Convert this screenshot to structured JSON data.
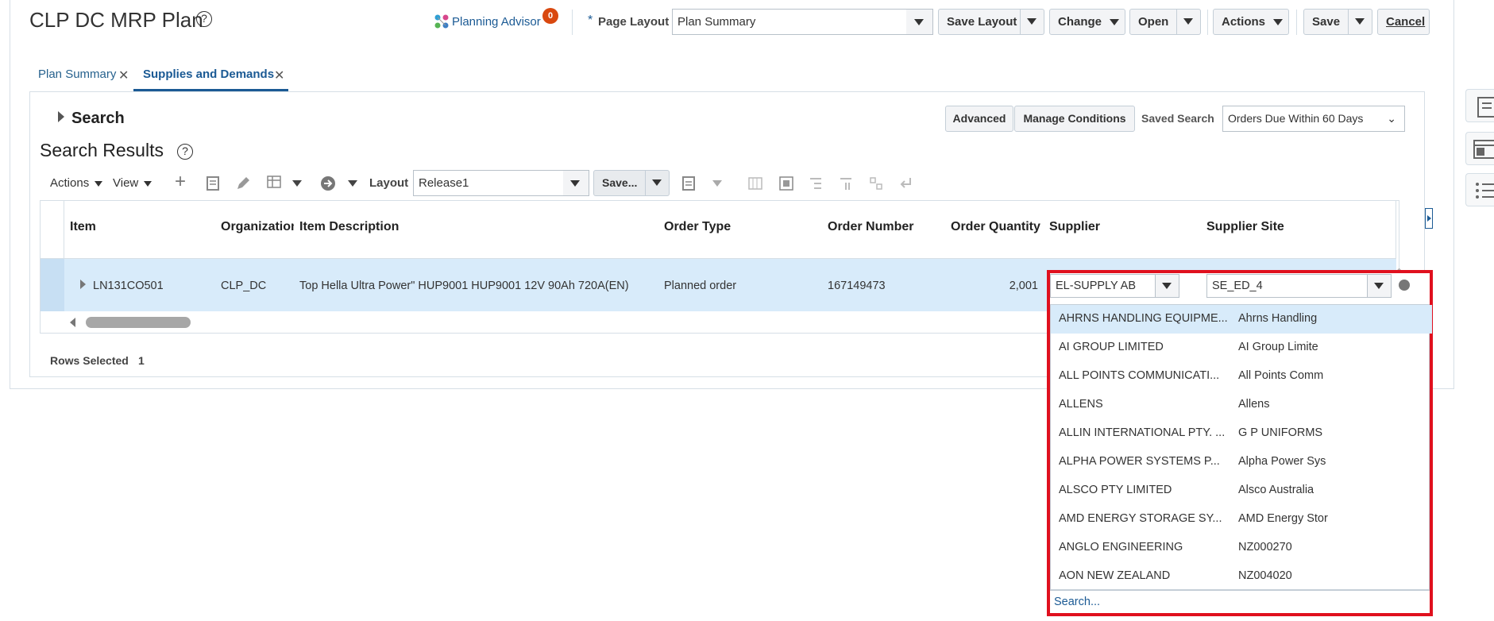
{
  "header": {
    "title": "CLP DC MRP Plan",
    "planning_advisor": "Planning Advisor",
    "advisor_badge": "0",
    "page_layout_label": "Page Layout",
    "page_layout_value": "Plan Summary",
    "save_layout": "Save Layout",
    "change": "Change",
    "open": "Open",
    "actions": "Actions",
    "save": "Save",
    "cancel": "Cancel"
  },
  "tabs": [
    {
      "label": "Plan Summary"
    },
    {
      "label": "Supplies and Demands"
    }
  ],
  "search": {
    "label": "Search",
    "advanced": "Advanced",
    "manage_conditions": "Manage Conditions",
    "saved_search_label": "Saved Search",
    "saved_search_value": "Orders Due Within 60 Days"
  },
  "results": {
    "title": "Search Results",
    "actions": "Actions",
    "view": "View",
    "layout_label": "Layout",
    "layout_value": "Release1",
    "save_btn": "Save...",
    "rows_selected_label": "Rows Selected",
    "rows_selected_count": "1"
  },
  "table": {
    "columns": [
      "Item",
      "Organization",
      "Item Description",
      "Order Type",
      "Order Number",
      "Order Quantity",
      "Supplier",
      "Supplier Site"
    ],
    "row": {
      "item": "LN131CO501",
      "organization": "CLP_DC",
      "description": "Top Hella Ultra Power\" HUP9001 HUP9001 12V 90Ah 720A(EN)",
      "order_type": "Planned order",
      "order_number": "167149473",
      "order_quantity": "2,001",
      "supplier": "EL-SUPPLY AB",
      "supplier_site": "SE_ED_4"
    }
  },
  "dropdown": {
    "items": [
      {
        "name": "AHRNS HANDLING EQUIPME...",
        "site": "Ahrns Handling"
      },
      {
        "name": "AI GROUP LIMITED",
        "site": "AI Group Limite"
      },
      {
        "name": "ALL POINTS COMMUNICATI...",
        "site": "All Points Comm"
      },
      {
        "name": "ALLENS",
        "site": "Allens"
      },
      {
        "name": "ALLIN INTERNATIONAL PTY. ...",
        "site": "G P UNIFORMS"
      },
      {
        "name": "ALPHA POWER SYSTEMS P...",
        "site": "Alpha Power Sys"
      },
      {
        "name": "ALSCO PTY LIMITED",
        "site": "Alsco Australia"
      },
      {
        "name": "AMD ENERGY STORAGE SY...",
        "site": "AMD Energy Stor"
      },
      {
        "name": "ANGLO ENGINEERING",
        "site": "NZ000270"
      },
      {
        "name": "AON NEW ZEALAND",
        "site": "NZ004020"
      }
    ],
    "search_link": "Search..."
  },
  "colors": {
    "link": "#1b5a94",
    "highlight_row": "#d8ebfa",
    "red_outline": "#e0101e",
    "badge": "#d9480f"
  }
}
